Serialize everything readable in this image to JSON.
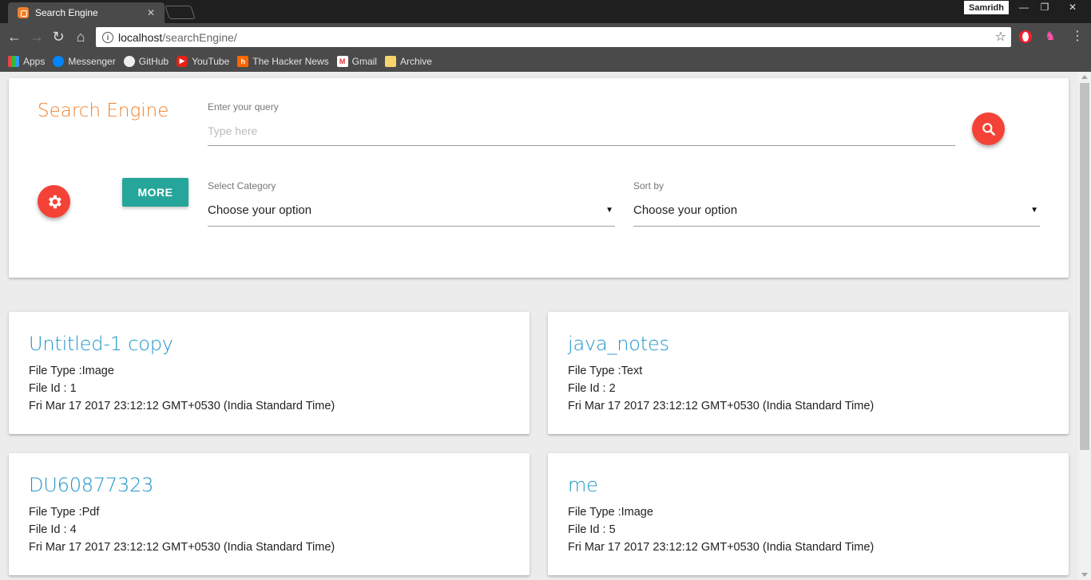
{
  "browser": {
    "tab_title": "Search Engine",
    "tab_close": "✕",
    "profile": "Samridh",
    "url_host": "localhost",
    "url_path": "/searchEngine/",
    "bookmarks": [
      {
        "label": "Apps",
        "icon": "apps-icon"
      },
      {
        "label": "Messenger",
        "icon": "messenger-icon"
      },
      {
        "label": "GitHub",
        "icon": "github-icon"
      },
      {
        "label": "YouTube",
        "icon": "youtube-icon"
      },
      {
        "label": "The Hacker News",
        "icon": "hacker-news-icon"
      },
      {
        "label": "Gmail",
        "icon": "gmail-icon"
      },
      {
        "label": "Archive",
        "icon": "folder-icon"
      }
    ]
  },
  "search": {
    "brand": "Search Engine",
    "query_label": "Enter your query",
    "query_placeholder": "Type here",
    "more_label": "MORE",
    "category_label": "Select Category",
    "category_value": "Choose your option",
    "sort_label": "Sort by",
    "sort_value": "Choose your option"
  },
  "colors": {
    "brand": "#f0812b",
    "fab": "#f44336",
    "more_button": "#26a69a",
    "link_title": "#2196c9"
  },
  "results": [
    {
      "title": "Untitled-1 copy",
      "type": "File Type :Image",
      "id": "File Id : 1",
      "date": "Fri Mar 17 2017 23:12:12 GMT+0530 (India Standard Time)"
    },
    {
      "title": "java_notes",
      "type": "File Type :Text",
      "id": "File Id : 2",
      "date": "Fri Mar 17 2017 23:12:12 GMT+0530 (India Standard Time)"
    },
    {
      "title": "DU60877323",
      "type": "File Type :Pdf",
      "id": "File Id : 4",
      "date": "Fri Mar 17 2017 23:12:12 GMT+0530 (India Standard Time)"
    },
    {
      "title": "me",
      "type": "File Type :Image",
      "id": "File Id : 5",
      "date": "Fri Mar 17 2017 23:12:12 GMT+0530 (India Standard Time)"
    }
  ]
}
